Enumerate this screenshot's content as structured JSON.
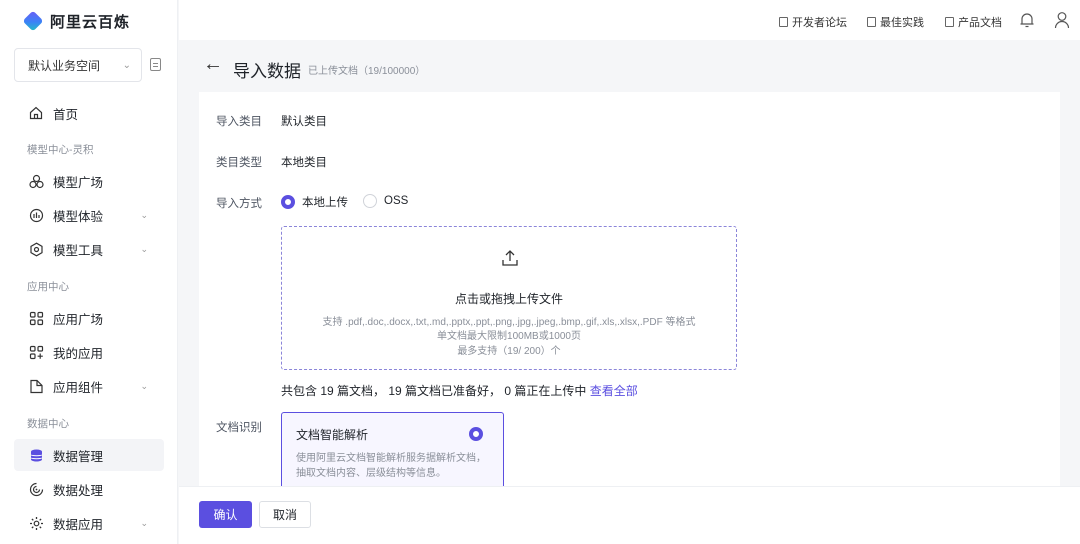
{
  "app": {
    "name": "阿里云百炼"
  },
  "sidebar": {
    "workspace": "默认业务空间",
    "items": [
      {
        "label": "首页"
      },
      {
        "label": "模型中心-灵积"
      },
      {
        "label": "模型广场"
      },
      {
        "label": "模型体验"
      },
      {
        "label": "模型工具"
      },
      {
        "label": "应用中心"
      },
      {
        "label": "应用广场"
      },
      {
        "label": "我的应用"
      },
      {
        "label": "应用组件"
      },
      {
        "label": "数据中心"
      },
      {
        "label": "数据管理"
      },
      {
        "label": "数据处理"
      },
      {
        "label": "数据应用"
      }
    ]
  },
  "topbar": {
    "links": [
      "开发者论坛",
      "最佳实践",
      "产品文档"
    ]
  },
  "page": {
    "title": "导入数据",
    "subtitle": "已上传文档（19/100000）"
  },
  "form": {
    "category_label": "导入类目",
    "category_value": "默认类目",
    "type_label": "类目类型",
    "type_value": "本地类目",
    "method_label": "导入方式",
    "method_options": [
      "本地上传",
      "OSS"
    ],
    "method_selected": "本地上传",
    "upload": {
      "title": "点击或拖拽上传文件",
      "formats": "支持 .pdf,.doc,.docx,.txt,.md,.pptx,.ppt,.png,.jpg,.jpeg,.bmp,.gif,.xls,.xlsx,.PDF 等格式",
      "limit": "单文档最大限制100MB或1000页",
      "max": "最多支持（19/ 200）个"
    },
    "summary": "共包含 19 篇文档， 19 篇文档已准备好， 0 篇正在上传中",
    "view_all": "查看全部",
    "recognition_label": "文档识别",
    "recognition_card": {
      "title": "文档智能解析",
      "desc": "使用阿里云文档智能解析服务据解析文档，抽取文档内容、层级结构等信息。"
    }
  },
  "footer": {
    "confirm": "确认",
    "cancel": "取消"
  },
  "colors": {
    "accent": "#5b4fe0"
  }
}
